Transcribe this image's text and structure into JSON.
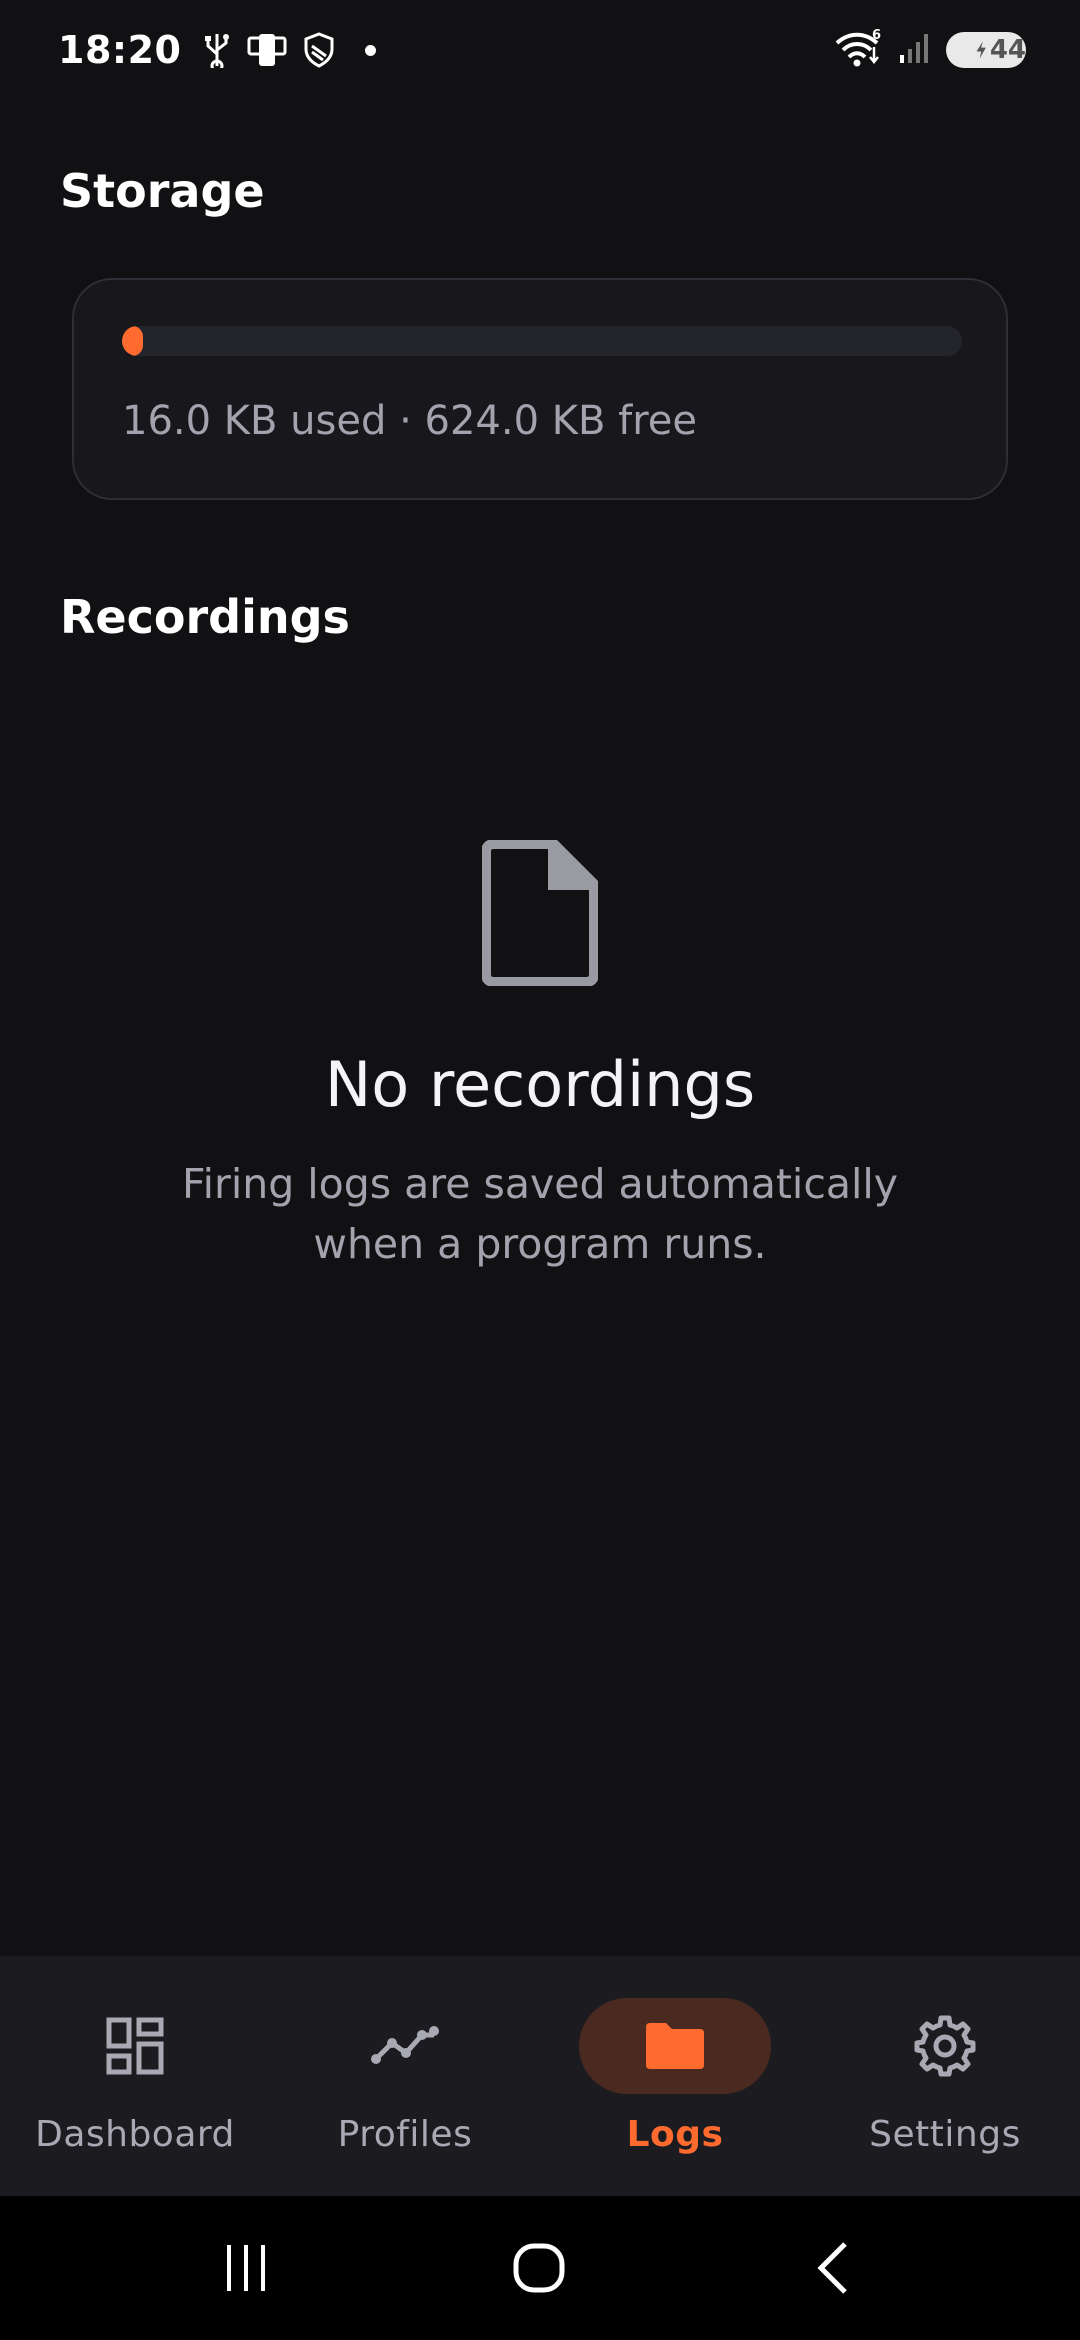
{
  "status_bar": {
    "time": "18:20",
    "battery_level": "44",
    "battery_percent": 44,
    "icons_left": [
      "usb-icon",
      "phone-link-icon",
      "shield-icon",
      "notification-dot"
    ],
    "icons_right": [
      "wifi-icon",
      "signal-icon",
      "battery-charging-icon"
    ],
    "wifi_badge": "6"
  },
  "storage": {
    "title": "Storage",
    "used_fraction": 0.025,
    "summary": "16.0 KB used · 624.0 KB free",
    "accent_color": "#ff6a2f"
  },
  "recordings": {
    "title": "Recordings",
    "empty_icon": "file-icon",
    "empty_title": "No recordings",
    "empty_description": "Firing logs are saved automatically when a program runs."
  },
  "bottom_nav": {
    "items": [
      {
        "label": "Dashboard",
        "icon": "dashboard-icon",
        "active": false
      },
      {
        "label": "Profiles",
        "icon": "profiles-chart-icon",
        "active": false
      },
      {
        "label": "Logs",
        "icon": "folder-icon",
        "active": true
      },
      {
        "label": "Settings",
        "icon": "gear-icon",
        "active": false
      }
    ]
  },
  "system_nav": {
    "buttons": [
      "recents-icon",
      "home-icon",
      "back-icon"
    ]
  }
}
